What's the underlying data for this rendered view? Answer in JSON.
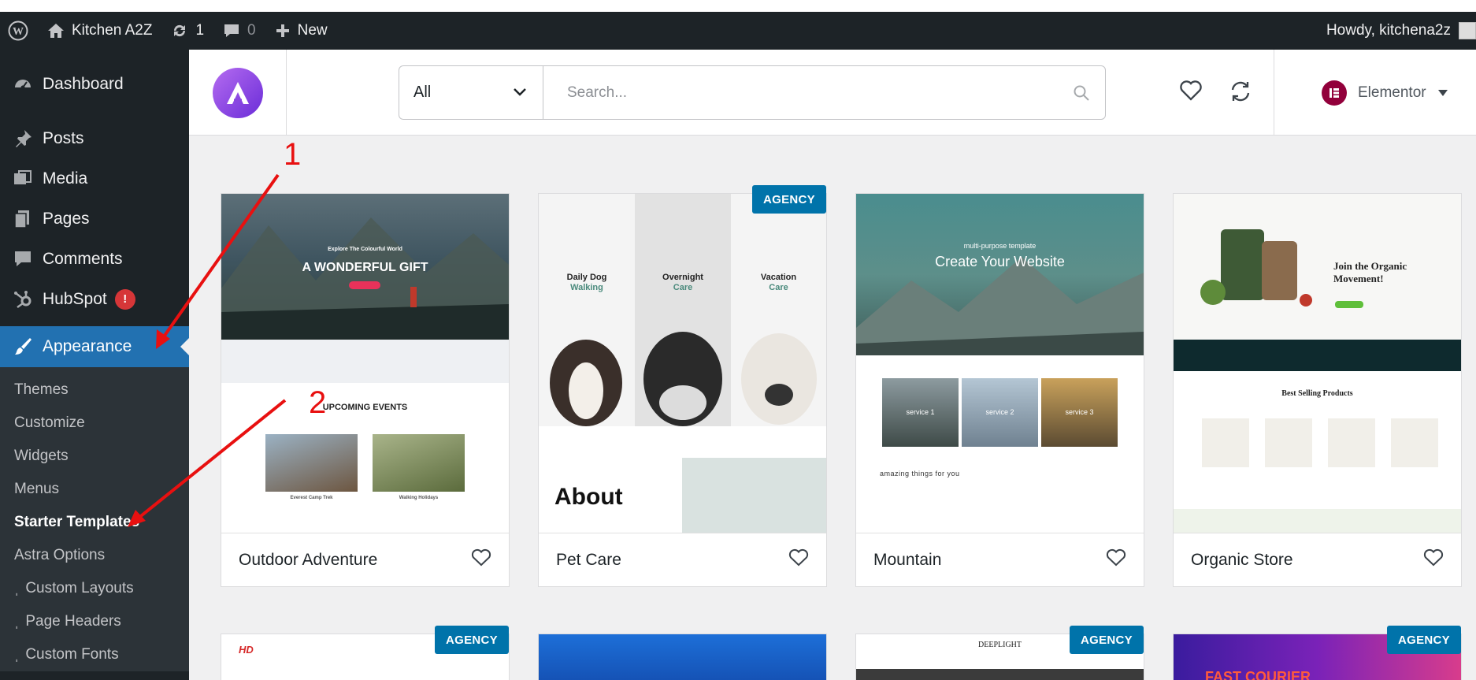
{
  "admin_bar": {
    "site_name": "Kitchen A2Z",
    "updates_count": "1",
    "comments_count": "0",
    "new_label": "New",
    "howdy": "Howdy, kitchena2z"
  },
  "sidebar": {
    "items": [
      {
        "label": "Dashboard",
        "icon": "dashboard-icon"
      },
      {
        "label": "Posts",
        "icon": "pin-icon"
      },
      {
        "label": "Media",
        "icon": "media-icon"
      },
      {
        "label": "Pages",
        "icon": "pages-icon"
      },
      {
        "label": "Comments",
        "icon": "comment-icon"
      },
      {
        "label": "HubSpot",
        "icon": "hubspot-icon",
        "badge": "!"
      },
      {
        "label": "Appearance",
        "icon": "brush-icon"
      }
    ],
    "submenu": [
      {
        "label": "Themes"
      },
      {
        "label": "Customize"
      },
      {
        "label": "Widgets"
      },
      {
        "label": "Menus"
      },
      {
        "label": "Starter Templates"
      },
      {
        "label": "Astra Options"
      },
      {
        "label": "Custom Layouts",
        "prefix": "ˌ"
      },
      {
        "label": "Page Headers",
        "prefix": "ˌ"
      },
      {
        "label": "Custom Fonts",
        "prefix": "ˌ"
      }
    ]
  },
  "toolbar": {
    "filter_value": "All",
    "search_placeholder": "Search...",
    "builder_label": "Elementor"
  },
  "templates": [
    {
      "name": "Outdoor Adventure",
      "agency": ""
    },
    {
      "name": "Pet Care",
      "agency": "AGENCY"
    },
    {
      "name": "Mountain",
      "agency": ""
    },
    {
      "name": "Organic Store",
      "agency": ""
    }
  ],
  "templates_row2": [
    {
      "agency": "AGENCY"
    },
    {
      "agency": ""
    },
    {
      "agency": "AGENCY"
    },
    {
      "agency": "AGENCY"
    }
  ],
  "previews": {
    "outdoor": {
      "kicker": "Explore The Colourful World",
      "headline": "A WONDERFUL GIFT",
      "events": "UPCOMING EVENTS",
      "event1": "Everest Camp Trek",
      "event2": "Walking Holidays"
    },
    "pet": {
      "c1": "Daily Dog",
      "c1b": "Walking",
      "c2": "Overnight",
      "c2b": "Care",
      "c3": "Vacation",
      "c3b": "Care",
      "about": "About"
    },
    "mountain": {
      "kicker": "multi-purpose template",
      "headline": "Create Your Website",
      "s1": "service 1",
      "s2": "service 2",
      "s3": "service 3",
      "tagline": "amazing things for you"
    },
    "organic": {
      "headline": "Join the Organic Movement!",
      "section": "Best Selling Products"
    },
    "row2": {
      "deeplight": "DEEPLIGHT",
      "courier": "FAST COURIER"
    }
  },
  "annotations": {
    "one": "1",
    "two": "2"
  },
  "colors": {
    "accent": "#2271b1",
    "agency": "#0073aa",
    "annotation": "#e81010"
  }
}
